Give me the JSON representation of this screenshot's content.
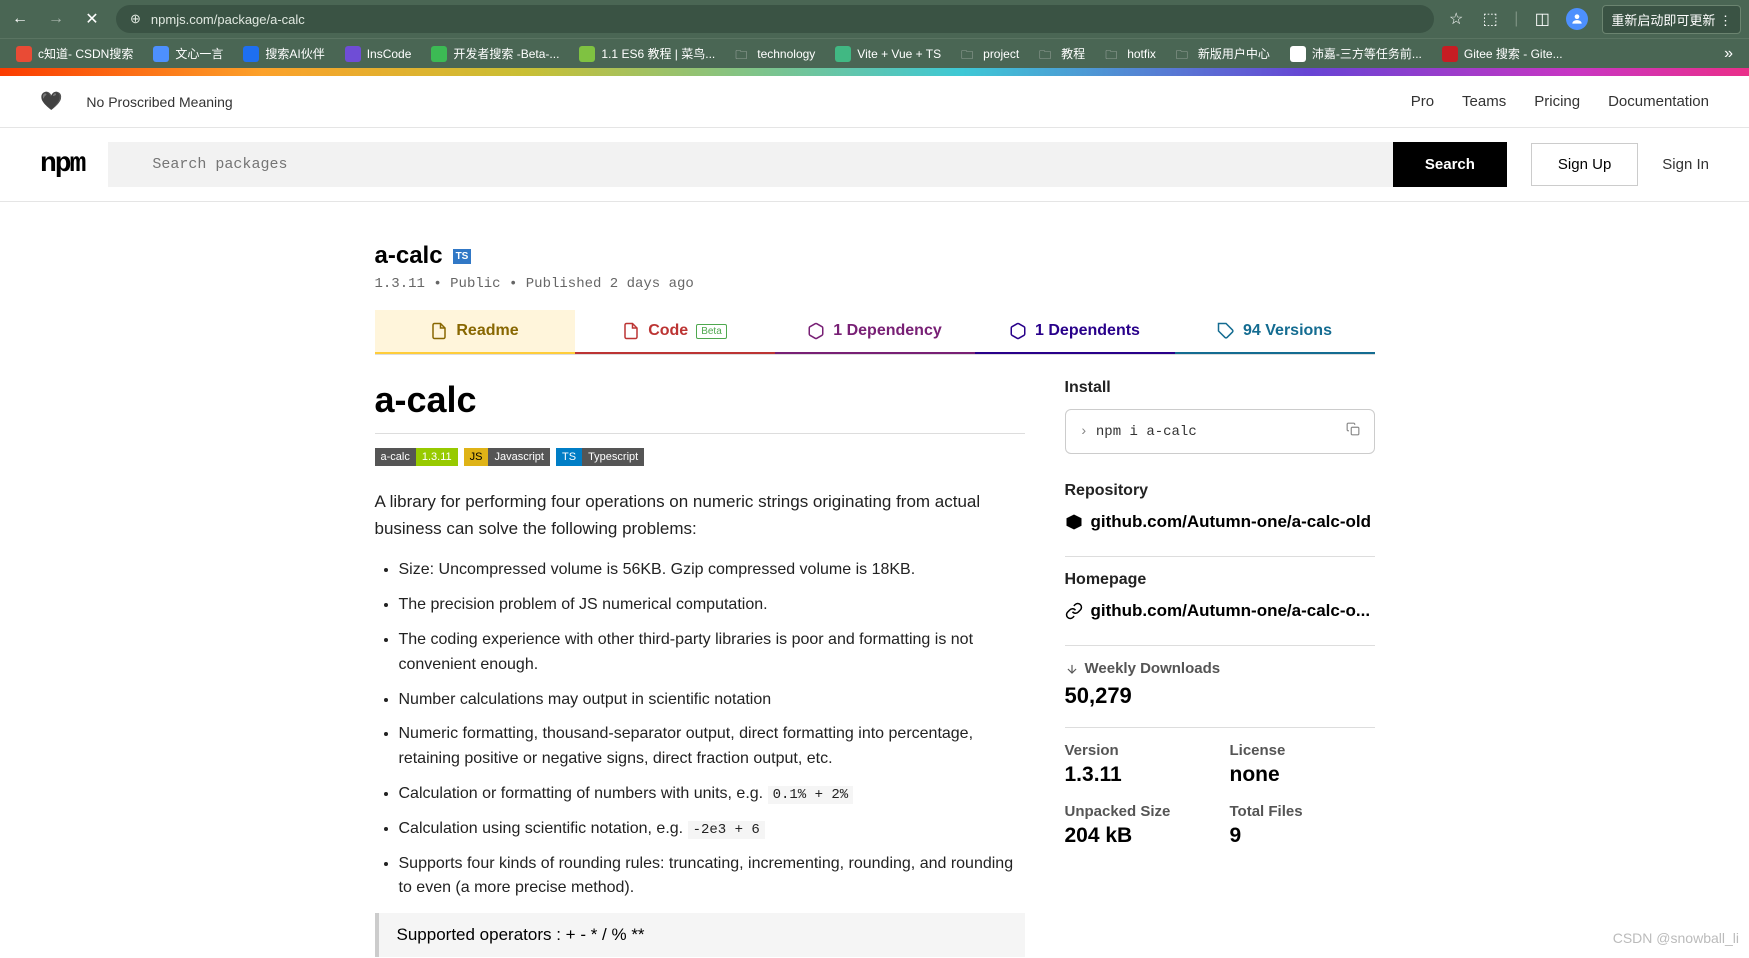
{
  "browser": {
    "url": "npmjs.com/package/a-calc",
    "update_btn": "重新启动即可更新",
    "bookmarks": [
      {
        "label": "c知道- CSDN搜索",
        "color": "#e94b35"
      },
      {
        "label": "文心一言",
        "color": "#4d90fe"
      },
      {
        "label": "搜索AI伙伴",
        "color": "#1e6ff1"
      },
      {
        "label": "InsCode",
        "color": "#6f4dd6"
      },
      {
        "label": "开发者搜索 -Beta-...",
        "color": "#3cba54"
      },
      {
        "label": "1.1 ES6 教程 | 菜鸟...",
        "color": "#7fc241"
      },
      {
        "label": "technology",
        "folder": true
      },
      {
        "label": "Vite + Vue + TS",
        "color": "#41b883"
      },
      {
        "label": "project",
        "folder": true
      },
      {
        "label": "教程",
        "folder": true
      },
      {
        "label": "hotfix",
        "folder": true
      },
      {
        "label": "新版用户中心",
        "folder": true
      },
      {
        "label": "沛嘉-三方等任务前...",
        "color": "#fff"
      },
      {
        "label": "Gitee 搜索 - Gite...",
        "color": "#c71d23"
      }
    ]
  },
  "top_nav": {
    "tagline": "No Proscribed Meaning",
    "links": [
      "Pro",
      "Teams",
      "Pricing",
      "Documentation"
    ]
  },
  "search": {
    "placeholder": "Search packages",
    "button": "Search",
    "signup": "Sign Up",
    "signin": "Sign In"
  },
  "pkg": {
    "name": "a-calc",
    "version": "1.3.11",
    "visibility": "Public",
    "published": "Published 2 days ago"
  },
  "tabs": {
    "readme": "Readme",
    "code": "Code",
    "code_beta": "Beta",
    "dependency": "1 Dependency",
    "dependents": "1 Dependents",
    "versions": "94 Versions"
  },
  "readme": {
    "h1": "a-calc",
    "badges": {
      "name": "a-calc",
      "ver": "1.3.11",
      "js": "Javascript",
      "ts": "Typescript"
    },
    "intro": "A library for performing four operations on numeric strings originating from actual business can solve the following problems:",
    "bullets": [
      "Size: Uncompressed volume is 56KB. Gzip compressed volume is 18KB.",
      "The precision problem of JS numerical computation.",
      "The coding experience with other third-party libraries is poor and formatting is not convenient enough.",
      "Number calculations may output in scientific notation"
    ],
    "bullet5_pre": "Numeric formatting, thousand-separator output, direct formatting into percentage, retaining positive or negative signs, direct fraction output, etc.",
    "bullet6_pre": "Calculation or formatting of numbers with units, e.g. ",
    "bullet6_code": "0.1% + 2%",
    "bullet7_pre": "Calculation using scientific notation, e.g. ",
    "bullet7_code": "-2e3 + 6",
    "bullet8": "Supports four kinds of rounding rules: truncating, incrementing, rounding, and rounding to even (a more precise method).",
    "supported": "Supported operators : + - * / % **"
  },
  "sidebar": {
    "install_h": "Install",
    "install_cmd": "npm i a-calc",
    "repo_h": "Repository",
    "repo": "github.com/Autumn-one/a-calc-old",
    "home_h": "Homepage",
    "home": "github.com/Autumn-one/a-calc-o...",
    "weekly_h": "Weekly Downloads",
    "weekly": "50,279",
    "version_h": "Version",
    "version_v": "1.3.11",
    "license_h": "License",
    "license_v": "none",
    "size_h": "Unpacked Size",
    "size_v": "204 kB",
    "files_h": "Total Files",
    "files_v": "9"
  },
  "watermark": "CSDN @snowball_li"
}
